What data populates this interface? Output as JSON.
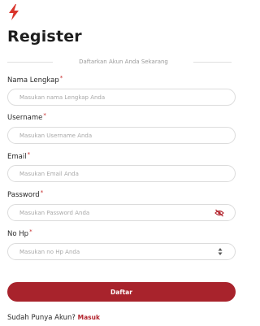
{
  "logo": {
    "icon": "lightning-bolt-icon",
    "color": "#d9342b"
  },
  "title": "Register",
  "subtitle": "Daftarkan Akun Anda Sekarang",
  "fields": [
    {
      "label": "Nama Lengkap",
      "required": "*",
      "placeholder": "Masukan nama Lengkap Anda",
      "value": ""
    },
    {
      "label": "Username",
      "required": "*",
      "placeholder": "Masukan Username Anda",
      "value": ""
    },
    {
      "label": "Email",
      "required": "*",
      "placeholder": "Masukan Email Anda",
      "value": ""
    },
    {
      "label": "Password",
      "required": "*",
      "placeholder": "Masukan Password Anda",
      "value": "",
      "icon": "eye-slash-icon"
    },
    {
      "label": "No Hp",
      "required": "*",
      "placeholder": "Masukan no Hp Anda",
      "value": "",
      "icon": "number-stepper-icon"
    }
  ],
  "submit_label": "Daftar",
  "footer": {
    "text": "Sudah Punya Akun?",
    "link": "Masuk"
  },
  "colors": {
    "accent": "#a8232c",
    "link": "#b3262f",
    "required": "#c62828"
  }
}
